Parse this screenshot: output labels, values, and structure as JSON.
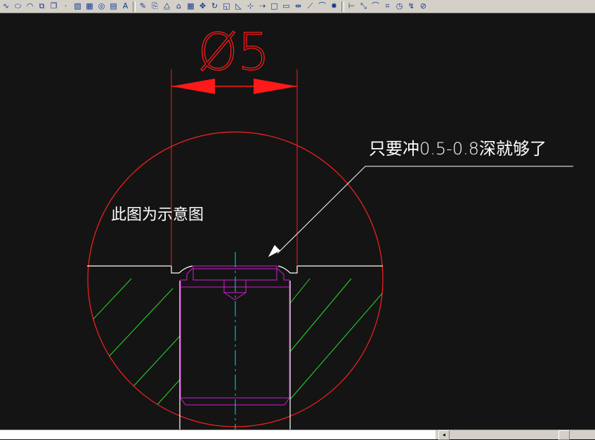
{
  "toolbar": {
    "icons": [
      {
        "name": "spline-icon",
        "glyph": "∿"
      },
      {
        "name": "ellipse-icon",
        "glyph": "⬭"
      },
      {
        "name": "ellipse-arc-icon",
        "glyph": "◠"
      },
      {
        "name": "insert-block-icon",
        "glyph": "⧉"
      },
      {
        "name": "make-block-icon",
        "glyph": "❐"
      },
      {
        "name": "point-icon",
        "glyph": "·"
      },
      {
        "name": "hatch-icon",
        "glyph": "▧"
      },
      {
        "name": "gradient-icon",
        "glyph": "▦"
      },
      {
        "name": "region-icon",
        "glyph": "◎"
      },
      {
        "name": "table-icon",
        "glyph": "▤"
      },
      {
        "name": "multiline-text-icon",
        "glyph": "A"
      },
      {
        "name": "erase-icon",
        "glyph": "✎"
      },
      {
        "name": "copy-icon",
        "glyph": "⎘"
      },
      {
        "name": "mirror-icon",
        "glyph": "⧋"
      },
      {
        "name": "offset-icon",
        "glyph": "⌂"
      },
      {
        "name": "array-icon",
        "glyph": "▦"
      },
      {
        "name": "move-icon",
        "glyph": "✥"
      },
      {
        "name": "rotate-icon",
        "glyph": "↻"
      },
      {
        "name": "scale-icon",
        "glyph": "◱"
      },
      {
        "name": "stretch-icon",
        "glyph": "◺"
      },
      {
        "name": "trim-icon",
        "glyph": "⊹"
      },
      {
        "name": "extend-icon",
        "glyph": "⇢"
      },
      {
        "name": "break-at-point-icon",
        "glyph": "□"
      },
      {
        "name": "break-icon",
        "glyph": "▭"
      },
      {
        "name": "join-icon",
        "glyph": "⇹"
      },
      {
        "name": "chamfer-icon",
        "glyph": "⟋"
      },
      {
        "name": "fillet-icon",
        "glyph": "⌒"
      },
      {
        "name": "explode-icon",
        "glyph": "✸"
      },
      {
        "name": "linear-dimension-icon",
        "glyph": "⊢"
      },
      {
        "name": "aligned-dimension-icon",
        "glyph": "⤡"
      },
      {
        "name": "arc-length-icon",
        "glyph": "⌒"
      },
      {
        "name": "ordinate-dimension-icon",
        "glyph": "⌗"
      },
      {
        "name": "radius-dimension-icon",
        "glyph": "◷"
      },
      {
        "name": "jogged-dimension-icon",
        "glyph": "↯"
      },
      {
        "name": "diameter-dimension-icon",
        "glyph": "⊘"
      }
    ],
    "separators_after": [
      10,
      27
    ]
  },
  "drawing": {
    "colors": {
      "background": "#141414",
      "detail_circle": "#ff2020",
      "dimension": "#ff1a1a",
      "outline": "#ffffff",
      "hatch": "#2bdc2b",
      "pin": "#d21bd2",
      "centerline": "#00d7d7",
      "leader": "#ffffff",
      "text": "#ffffff"
    },
    "dimension_text": "Ø5",
    "leader_note": "只要冲0.5-0.8深就够了",
    "caption": "此图为示意图"
  },
  "scrollbar": {
    "left_arrow_glyph": "◂"
  }
}
